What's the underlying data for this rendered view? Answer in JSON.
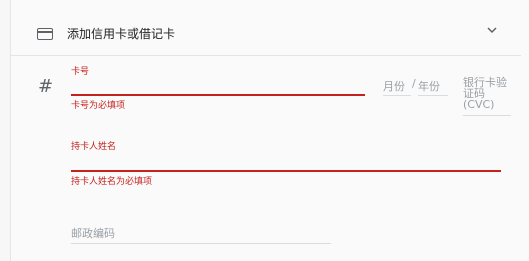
{
  "header": {
    "card_icon": "credit-card-icon",
    "title": "添加信用卡或借记卡",
    "expand_icon": "chevron-down-icon"
  },
  "form": {
    "hash_symbol": "#",
    "card_number": {
      "label": "卡号",
      "value": "",
      "error": "卡号为必填项"
    },
    "expiry_month": {
      "placeholder": "月份"
    },
    "expiry_separator": "/",
    "expiry_year": {
      "placeholder": "年份"
    },
    "cvc": {
      "placeholder": "银行卡验证码 (CVC)"
    },
    "cardholder_name": {
      "label": "持卡人姓名",
      "value": "",
      "error": "持卡人姓名为必填项"
    },
    "postal_code": {
      "placeholder": "邮政编码"
    }
  },
  "colors": {
    "error": "#c5221f",
    "text": "#202124",
    "muted": "#9aa0a6"
  }
}
